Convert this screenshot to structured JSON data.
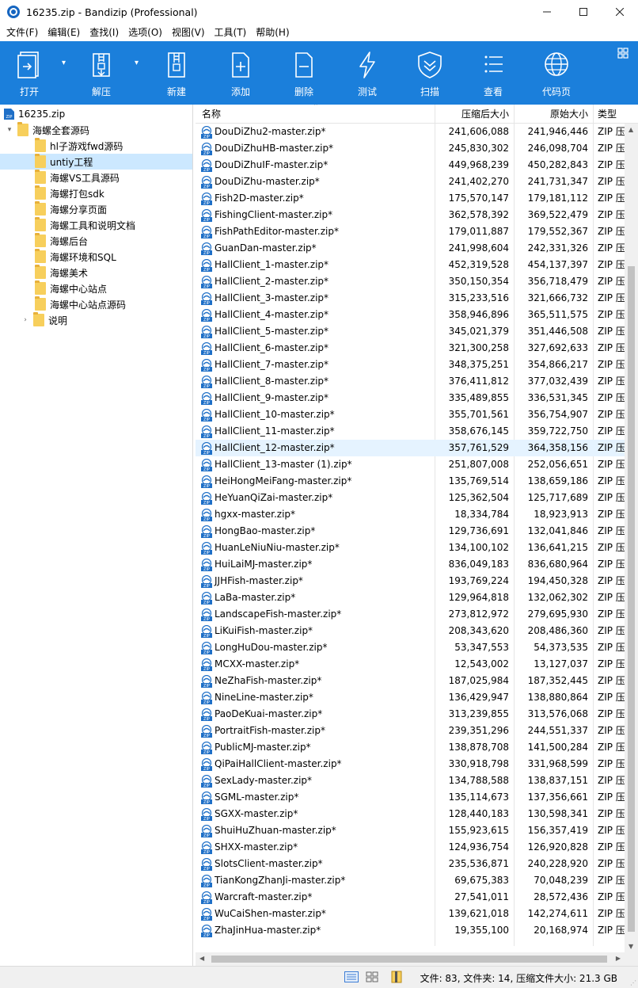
{
  "window": {
    "title": "16235.zip - Bandizip (Professional)",
    "minimize": "—",
    "maximize": "☐",
    "close": "✕"
  },
  "menu": [
    "文件(F)",
    "编辑(E)",
    "查找(I)",
    "选项(O)",
    "视图(V)",
    "工具(T)",
    "帮助(H)"
  ],
  "toolbar": {
    "open": "打开",
    "extract": "解压",
    "new": "新建",
    "add": "添加",
    "delete": "删除",
    "test": "测试",
    "scan": "扫描",
    "view": "查看",
    "codepage": "代码页"
  },
  "tree": {
    "root": "16235.zip",
    "folder": "海螺全套源码",
    "children": [
      "hl子游戏fwd源码",
      "untiy工程",
      "海螺VS工具源码",
      "海螺打包sdk",
      "海螺分享页面",
      "海螺工具和说明文档",
      "海螺后台",
      "海螺环境和SQL",
      "海螺美术",
      "海螺中心站点",
      "海螺中心站点源码"
    ],
    "selected_index": 1,
    "sibling": "说明"
  },
  "columns": {
    "name": "名称",
    "compressed": "压缩后大小",
    "original": "原始大小",
    "type": "类型"
  },
  "type_value": "ZIP 压",
  "files": [
    [
      "DouDiZhu2-master.zip*",
      "241,606,088",
      "241,946,446"
    ],
    [
      "DouDiZhuHB-master.zip*",
      "245,830,302",
      "246,098,704"
    ],
    [
      "DouDiZhuIF-master.zip*",
      "449,968,239",
      "450,282,843"
    ],
    [
      "DouDiZhu-master.zip*",
      "241,402,270",
      "241,731,347"
    ],
    [
      "Fish2D-master.zip*",
      "175,570,147",
      "179,181,112"
    ],
    [
      "FishingClient-master.zip*",
      "362,578,392",
      "369,522,479"
    ],
    [
      "FishPathEditor-master.zip*",
      "179,011,887",
      "179,552,367"
    ],
    [
      "GuanDan-master.zip*",
      "241,998,604",
      "242,331,326"
    ],
    [
      "HallClient_1-master.zip*",
      "452,319,528",
      "454,137,397"
    ],
    [
      "HallClient_2-master.zip*",
      "350,150,354",
      "356,718,479"
    ],
    [
      "HallClient_3-master.zip*",
      "315,233,516",
      "321,666,732"
    ],
    [
      "HallClient_4-master.zip*",
      "358,946,896",
      "365,511,575"
    ],
    [
      "HallClient_5-master.zip*",
      "345,021,379",
      "351,446,508"
    ],
    [
      "HallClient_6-master.zip*",
      "321,300,258",
      "327,692,633"
    ],
    [
      "HallClient_7-master.zip*",
      "348,375,251",
      "354,866,217"
    ],
    [
      "HallClient_8-master.zip*",
      "376,411,812",
      "377,032,439"
    ],
    [
      "HallClient_9-master.zip*",
      "335,489,855",
      "336,531,345"
    ],
    [
      "HallClient_10-master.zip*",
      "355,701,561",
      "356,754,907"
    ],
    [
      "HallClient_11-master.zip*",
      "358,676,145",
      "359,722,750"
    ],
    [
      "HallClient_12-master.zip*",
      "357,761,529",
      "364,358,156"
    ],
    [
      "HallClient_13-master (1).zip*",
      "251,807,008",
      "252,056,651"
    ],
    [
      "HeiHongMeiFang-master.zip*",
      "135,769,514",
      "138,659,186"
    ],
    [
      "HeYuanQiZai-master.zip*",
      "125,362,504",
      "125,717,689"
    ],
    [
      "hgxx-master.zip*",
      "18,334,784",
      "18,923,913"
    ],
    [
      "HongBao-master.zip*",
      "129,736,691",
      "132,041,846"
    ],
    [
      "HuanLeNiuNiu-master.zip*",
      "134,100,102",
      "136,641,215"
    ],
    [
      "HuiLaiMJ-master.zip*",
      "836,049,183",
      "836,680,964"
    ],
    [
      "JJHFish-master.zip*",
      "193,769,224",
      "194,450,328"
    ],
    [
      "LaBa-master.zip*",
      "129,964,818",
      "132,062,302"
    ],
    [
      "LandscapeFish-master.zip*",
      "273,812,972",
      "279,695,930"
    ],
    [
      "LiKuiFish-master.zip*",
      "208,343,620",
      "208,486,360"
    ],
    [
      "LongHuDou-master.zip*",
      "53,347,553",
      "54,373,535"
    ],
    [
      "MCXX-master.zip*",
      "12,543,002",
      "13,127,037"
    ],
    [
      "NeZhaFish-master.zip*",
      "187,025,984",
      "187,352,445"
    ],
    [
      "NineLine-master.zip*",
      "136,429,947",
      "138,880,864"
    ],
    [
      "PaoDeKuai-master.zip*",
      "313,239,855",
      "313,576,068"
    ],
    [
      "PortraitFish-master.zip*",
      "239,351,296",
      "244,551,337"
    ],
    [
      "PublicMJ-master.zip*",
      "138,878,708",
      "141,500,284"
    ],
    [
      "QiPaiHallClient-master.zip*",
      "330,918,798",
      "331,968,599"
    ],
    [
      "SexLady-master.zip*",
      "134,788,588",
      "138,837,151"
    ],
    [
      "SGML-master.zip*",
      "135,114,673",
      "137,356,661"
    ],
    [
      "SGXX-master.zip*",
      "128,440,183",
      "130,598,341"
    ],
    [
      "ShuiHuZhuan-master.zip*",
      "155,923,615",
      "156,357,419"
    ],
    [
      "SHXX-master.zip*",
      "124,936,754",
      "126,920,828"
    ],
    [
      "SlotsClient-master.zip*",
      "235,536,871",
      "240,228,920"
    ],
    [
      "TianKongZhanJi-master.zip*",
      "69,675,383",
      "70,048,239"
    ],
    [
      "Warcraft-master.zip*",
      "27,541,011",
      "28,572,436"
    ],
    [
      "WuCaiShen-master.zip*",
      "139,621,018",
      "142,274,611"
    ],
    [
      "ZhaJinHua-master.zip*",
      "19,355,100",
      "20,168,974"
    ]
  ],
  "selected_file_index": 19,
  "status": "文件: 83, 文件夹: 14, 压缩文件大小: 21.3 GB",
  "colors": {
    "toolbar_bg": "#1b7fdb",
    "selection": "#cce8ff",
    "folder": "#f7cf5c",
    "zip_icon": "#1e6fc7"
  }
}
